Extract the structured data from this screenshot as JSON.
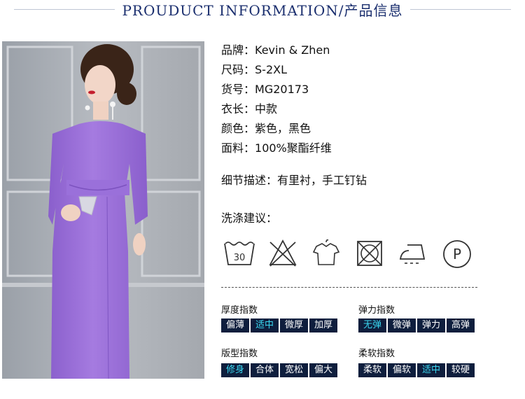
{
  "header": {
    "title": "PROUDUCT INFORMATION/产品信息"
  },
  "specs": [
    {
      "label": "品牌：",
      "value": "Kevin & Zhen"
    },
    {
      "label": "尺码：",
      "value": "S-2XL"
    },
    {
      "label": "货号：",
      "value": "MG20173"
    },
    {
      "label": "衣长：",
      "value": "中款"
    },
    {
      "label": "颜色：",
      "value": "紫色，黑色"
    },
    {
      "label": "面料：",
      "value": "100%聚酯纤维"
    }
  ],
  "detail": {
    "label": "细节描述：",
    "value": "有里衬，手工钉钻"
  },
  "care": {
    "label": "洗涤建议：",
    "icons": [
      "wash-30-icon",
      "no-bleach-icon",
      "hang-dry-icon",
      "no-tumble-dry-icon",
      "iron-low-icon",
      "dry-clean-p-icon"
    ],
    "wash_temp": "30",
    "dry_clean_letter": "P"
  },
  "indices": [
    {
      "title": "厚度指数",
      "options": [
        "偏薄",
        "适中",
        "微厚",
        "加厚"
      ],
      "selected": "适中"
    },
    {
      "title": "弹力指数",
      "options": [
        "无弹",
        "微弹",
        "弹力",
        "高弹"
      ],
      "selected": "无弹"
    },
    {
      "title": "版型指数",
      "options": [
        "修身",
        "合体",
        "宽松",
        "偏大"
      ],
      "selected": "修身"
    },
    {
      "title": "柔软指数",
      "options": [
        "柔软",
        "偏软",
        "适中",
        "较硬"
      ],
      "selected": "适中"
    }
  ],
  "colors": {
    "dress": "#9b6fd8",
    "navy": "#0e1e3d",
    "active": "#3ad7f0",
    "title": "#1a2e6e"
  }
}
